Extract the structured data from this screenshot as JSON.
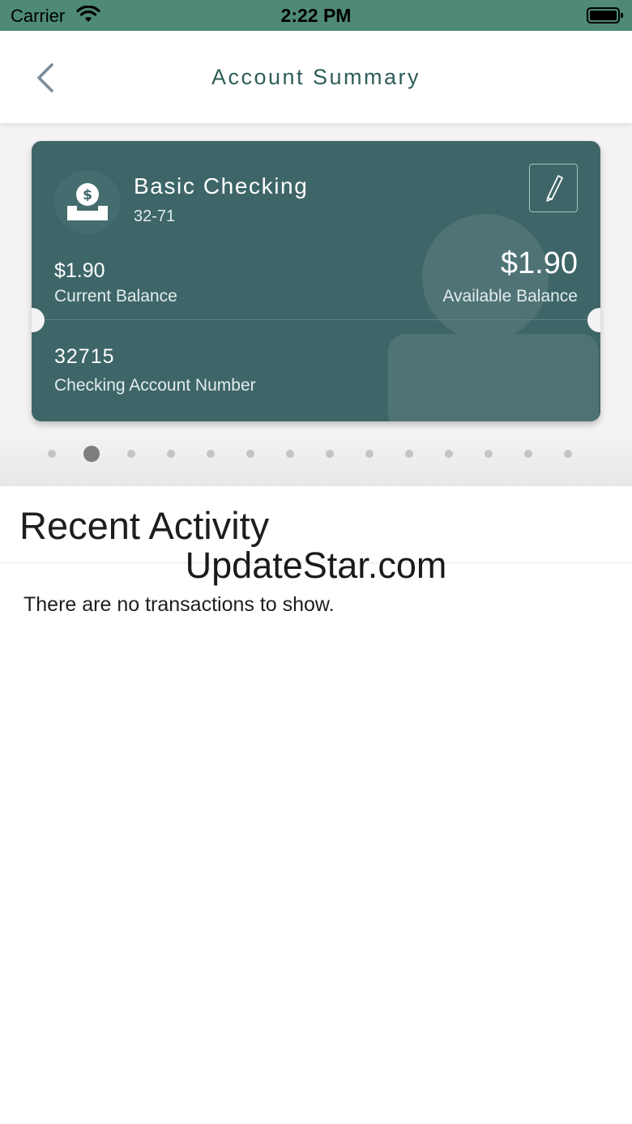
{
  "status_bar": {
    "carrier": "Carrier",
    "time": "2:22 PM"
  },
  "nav": {
    "title": "Account Summary",
    "back_icon": "chevron-left-icon"
  },
  "card": {
    "name": "Basic Checking",
    "subtitle": "32-71",
    "icon": "money-deposit-icon",
    "edit_icon": "pencil-icon",
    "current_balance": {
      "amount": "$1.90",
      "label": "Current Balance"
    },
    "available_balance": {
      "amount": "$1.90",
      "label": "Available Balance"
    },
    "account_number": {
      "value": "32715",
      "label": "Checking Account Number"
    },
    "color": "#3e6668"
  },
  "pagination": {
    "count": 14,
    "active_index": 1
  },
  "recent_activity": {
    "title": "Recent Activity",
    "empty_message": "There are no transactions to show."
  },
  "watermark": "UpdateStar.com",
  "colors": {
    "status_bar": "#4e8a74",
    "accent": "#2e5d59"
  }
}
